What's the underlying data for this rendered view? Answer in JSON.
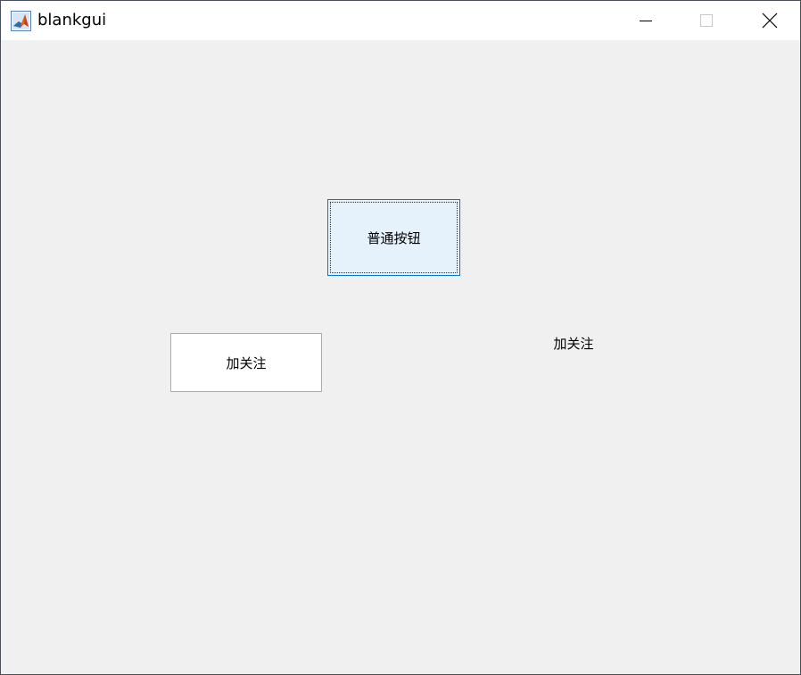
{
  "window": {
    "title": "blankgui",
    "app_icon": "matlab-logo-icon",
    "controls": {
      "minimize_icon": "minimize-icon",
      "maximize_icon": "maximize-icon",
      "close_icon": "close-icon"
    }
  },
  "content": {
    "push_button_label": "普通按钮",
    "follow_button_label": "加关注",
    "static_text_label": "加关注"
  },
  "colors": {
    "focused_button_bg": "#e5f1fb",
    "focused_button_border": "#0078d7",
    "figure_background": "#f0f0f0"
  }
}
